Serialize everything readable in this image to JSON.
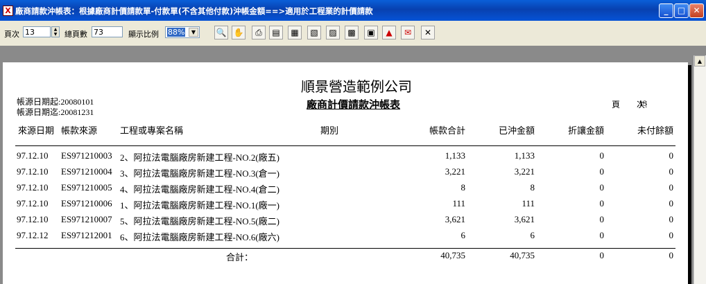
{
  "window": {
    "title": "廠商請款沖帳表：根據廠商計價請款單-付款單(不含其他付款)沖帳金額==>適用於工程業的計價請款",
    "app_icon": "report-app-icon",
    "buttons": [
      "minimize-icon",
      "maximize-icon",
      "close-icon"
    ]
  },
  "toolbar": {
    "page_label": "頁次",
    "page_value": "13",
    "total_label": "總頁數",
    "total_value": "73",
    "zoom_label": "顯示比例",
    "zoom_value": "88%",
    "tools": [
      "zoom-icon",
      "hand-icon",
      "print-icon",
      "document-icon",
      "export-icon",
      "excel-icon",
      "word-icon",
      "html-icon",
      "save-icon",
      "pdf-icon",
      "email-icon",
      "close-icon"
    ]
  },
  "report": {
    "company": "順景營造範例公司",
    "title": "廠商計價請款沖帳表",
    "date_from": "帳源日期起:20080101",
    "date_to": "帳源日期迄:20081231",
    "page_label": "頁　　次:",
    "page_no": "13",
    "columns": [
      "來源日期",
      "帳款來源",
      "工程或專案名稱",
      "期別",
      "帳款合計",
      "已沖金額",
      "折讓金額",
      "未付餘額"
    ],
    "rows": [
      {
        "date": "97.12.10",
        "source": "ES971210003",
        "project": "2、阿拉法電腦廠房新建工程-NO.2(廠五)",
        "period": "",
        "total": "1,133",
        "paid": "1,133",
        "discount": "0",
        "balance": "0"
      },
      {
        "date": "97.12.10",
        "source": "ES971210004",
        "project": "3、阿拉法電腦廠房新建工程-NO.3(倉一)",
        "period": "",
        "total": "3,221",
        "paid": "3,221",
        "discount": "0",
        "balance": "0"
      },
      {
        "date": "97.12.10",
        "source": "ES971210005",
        "project": "4、阿拉法電腦廠房新建工程-NO.4(倉二)",
        "period": "",
        "total": "8",
        "paid": "8",
        "discount": "0",
        "balance": "0"
      },
      {
        "date": "97.12.10",
        "source": "ES971210006",
        "project": "1、阿拉法電腦廠房新建工程-NO.1(廠一)",
        "period": "",
        "total": "111",
        "paid": "111",
        "discount": "0",
        "balance": "0"
      },
      {
        "date": "97.12.10",
        "source": "ES971210007",
        "project": "5、阿拉法電腦廠房新建工程-NO.5(廠二)",
        "period": "",
        "total": "3,621",
        "paid": "3,621",
        "discount": "0",
        "balance": "0"
      },
      {
        "date": "97.12.12",
        "source": "ES971212001",
        "project": "6、阿拉法電腦廠房新建工程-NO.6(廠六)",
        "period": "",
        "total": "6",
        "paid": "6",
        "discount": "0",
        "balance": "0"
      }
    ],
    "sum": {
      "label": "合計：",
      "total": "40,735",
      "paid": "40,735",
      "discount": "0",
      "balance": "0"
    }
  }
}
